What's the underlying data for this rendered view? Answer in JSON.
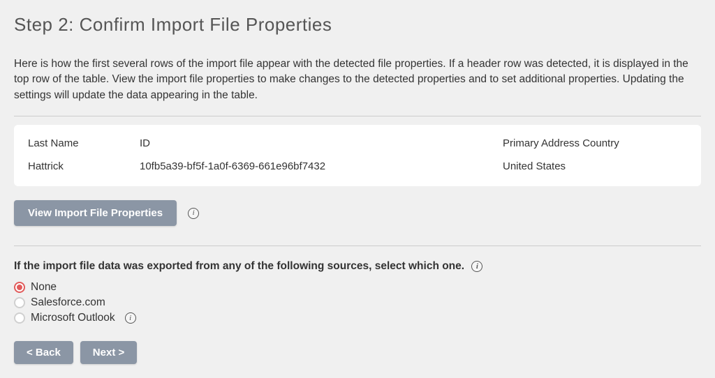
{
  "heading": "Step 2: Confirm Import File Properties",
  "intro": "Here is how the first several rows of the import file appear with the detected file properties. If a header row was detected, it is displayed in the top row of the table. View the import file properties to make changes to the detected properties and to set additional properties. Updating the settings will update the data appearing in the table.",
  "table": {
    "headers": {
      "last_name": "Last Name",
      "id": "ID",
      "country": "Primary Address Country"
    },
    "row": {
      "last_name": "Hattrick",
      "id": "10fb5a39-bf5f-1a0f-6369-661e96bf7432",
      "country": "United States"
    }
  },
  "buttons": {
    "view_props": "View Import File Properties",
    "back": "< Back",
    "next": "Next >"
  },
  "source_prompt": "If the import file data was exported from any of the following sources, select which one.",
  "sources": {
    "none": "None",
    "salesforce": "Salesforce.com",
    "outlook": "Microsoft Outlook"
  }
}
